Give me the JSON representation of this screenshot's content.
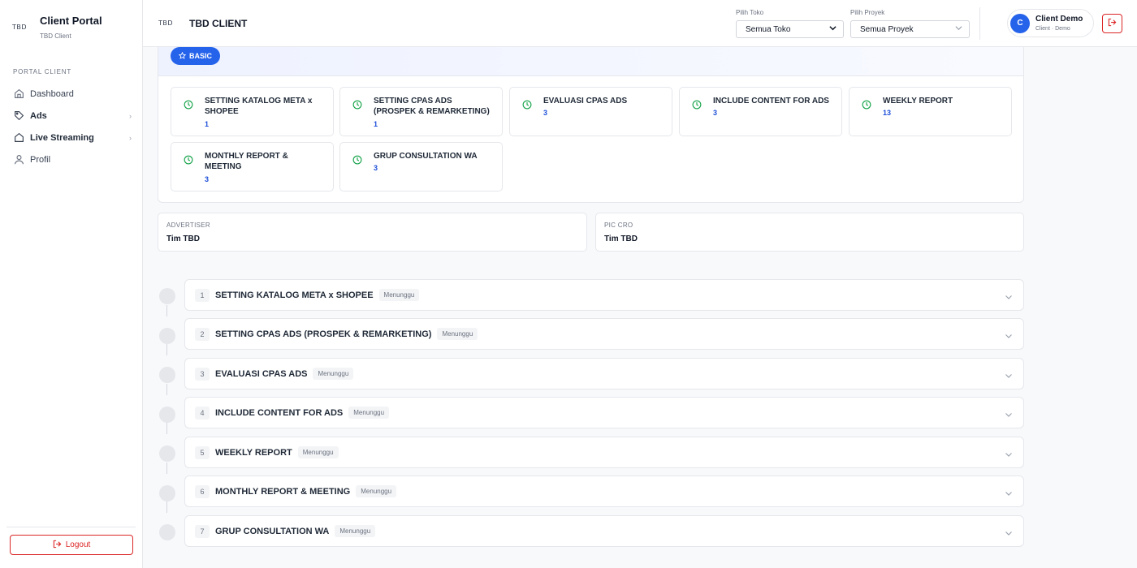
{
  "sidebar": {
    "logo": "TBD",
    "title": "Client Portal",
    "subtitle": "TBD Client",
    "section_label": "PORTAL CLIENT",
    "items": [
      {
        "label": "Dashboard",
        "icon": "home-icon"
      },
      {
        "label": "Ads",
        "icon": "tag-icon"
      },
      {
        "label": "Live Streaming",
        "icon": "home-icon"
      },
      {
        "label": "Profil",
        "icon": "user-icon"
      }
    ],
    "logout_label": "Logout"
  },
  "header": {
    "logo": "TBD",
    "title": "TBD CLIENT",
    "toko": {
      "caption": "Pilih Toko",
      "value": "Semua Toko"
    },
    "proyek": {
      "caption": "Pilih Proyek",
      "value": "Semua Proyek"
    },
    "user": {
      "initial": "C",
      "name": "Client Demo",
      "role": "Client · Demo"
    }
  },
  "package": {
    "badge": "BASIC",
    "services": [
      {
        "name": "SETTING KATALOG META x SHOPEE",
        "count": "1"
      },
      {
        "name": "SETTING CPAS ADS (PROSPEK & REMARKETING)",
        "count": "1"
      },
      {
        "name": "EVALUASI CPAS ADS",
        "count": "3"
      },
      {
        "name": "INCLUDE CONTENT FOR ADS",
        "count": "3"
      },
      {
        "name": "WEEKLY REPORT",
        "count": "13"
      },
      {
        "name": "MONTHLY REPORT & MEETING",
        "count": "3"
      },
      {
        "name": "GRUP CONSULTATION WA",
        "count": "3"
      }
    ]
  },
  "info": {
    "advertiser": {
      "caption": "ADVERTISER",
      "value": "Tim TBD"
    },
    "pic": {
      "caption": "PIC CRO",
      "value": "Tim TBD"
    }
  },
  "steps": [
    {
      "num": "1",
      "name": "SETTING KATALOG META x SHOPEE",
      "status": "Menunggu"
    },
    {
      "num": "2",
      "name": "SETTING CPAS ADS (PROSPEK & REMARKETING)",
      "status": "Menunggu"
    },
    {
      "num": "3",
      "name": "EVALUASI CPAS ADS",
      "status": "Menunggu"
    },
    {
      "num": "4",
      "name": "INCLUDE CONTENT FOR ADS",
      "status": "Menunggu"
    },
    {
      "num": "5",
      "name": "WEEKLY REPORT",
      "status": "Menunggu"
    },
    {
      "num": "6",
      "name": "MONTHLY REPORT & MEETING",
      "status": "Menunggu"
    },
    {
      "num": "7",
      "name": "GRUP CONSULTATION WA",
      "status": "Menunggu"
    }
  ],
  "colors": {
    "accent": "#2563eb",
    "danger": "#dc2626",
    "success": "#16a34a"
  }
}
